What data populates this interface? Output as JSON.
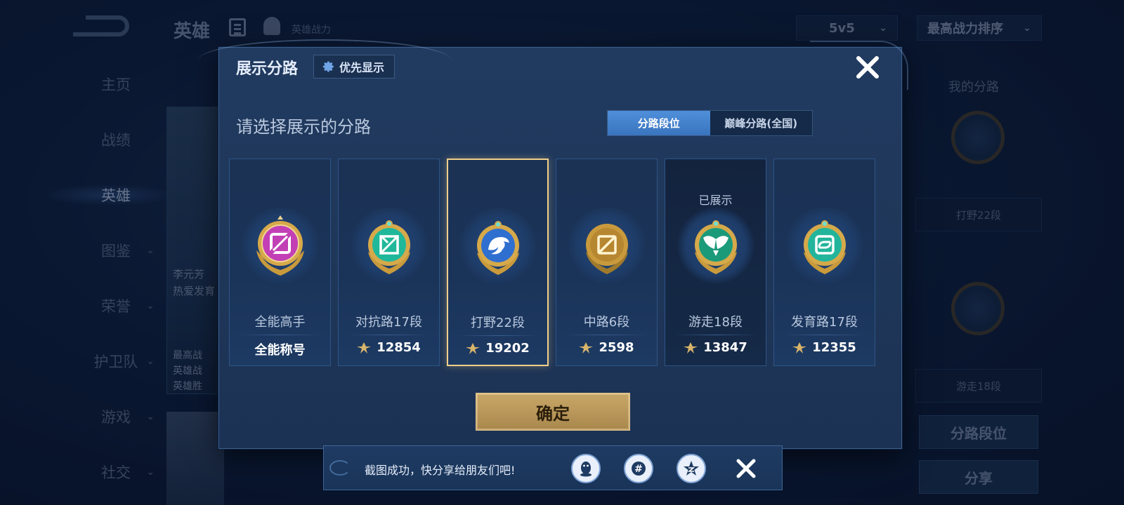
{
  "background": {
    "header_title": "英雄",
    "header_sub": "英雄战力",
    "mode_select": "5v5",
    "sort_select": "最高战力排序",
    "sidebar": [
      {
        "label": "主页"
      },
      {
        "label": "战绩"
      },
      {
        "label": "英雄",
        "active": true
      },
      {
        "label": "图鉴"
      },
      {
        "label": "荣誉"
      },
      {
        "label": "护卫队"
      },
      {
        "label": "游戏"
      },
      {
        "label": "社交"
      }
    ],
    "card_texts": [
      "李元芳",
      "热爱发育",
      "最高战",
      "英雄战",
      "英雄胜"
    ],
    "right_panel": {
      "title": "我的分路",
      "lane1": "打野22段",
      "lane2": "游走18段",
      "btn1": "分路段位",
      "btn2": "分享"
    }
  },
  "modal": {
    "title": "展示分路",
    "priority_label": "优先显示",
    "prompt": "请选择展示的分路",
    "tabs": [
      {
        "label": "分路段位",
        "active": true
      },
      {
        "label": "巅峰分路(全国)",
        "active": false
      }
    ],
    "lanes": [
      {
        "name": "全能高手",
        "value": "全能称号",
        "icon": "all-round-badge-icon",
        "color": "#c23fb6",
        "shown": ""
      },
      {
        "name": "对抗路17段",
        "value": "12854",
        "icon": "clash-lane-badge-icon",
        "color": "#1fb89a",
        "shown": ""
      },
      {
        "name": "打野22段",
        "value": "19202",
        "icon": "jungle-badge-icon",
        "color": "#2f6fd0",
        "shown": "",
        "selected": true
      },
      {
        "name": "中路6段",
        "value": "2598",
        "icon": "mid-lane-badge-icon",
        "color": "#b78630",
        "shown": ""
      },
      {
        "name": "游走18段",
        "value": "13847",
        "icon": "roam-badge-icon",
        "color": "#1b9a7a",
        "shown": "已展示"
      },
      {
        "name": "发育路17段",
        "value": "12355",
        "icon": "farm-lane-badge-icon",
        "color": "#22b59b",
        "shown": ""
      }
    ],
    "confirm_label": "确定"
  },
  "toast": {
    "text": "截图成功，快分享给朋友们吧!",
    "share_targets": [
      "qq-icon",
      "wechat-moments-icon",
      "qzone-star-icon"
    ]
  }
}
